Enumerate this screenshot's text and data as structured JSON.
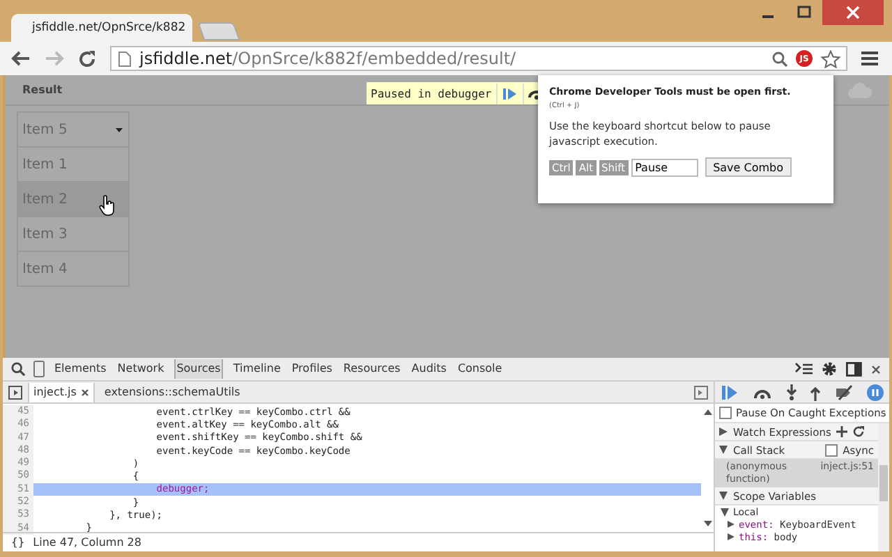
{
  "browser": {
    "tab_title": "jsfiddle.net/OpnSrce/k882",
    "url_host": "jsfiddle.net",
    "url_path": "/OpnSrce/k882f/embedded/result/",
    "extension_badge": "JS"
  },
  "page": {
    "header": "Result",
    "menu_items": [
      {
        "label": "Item 5",
        "kind": "dropdown",
        "hovered": false
      },
      {
        "label": "Item 1",
        "kind": "item",
        "hovered": false
      },
      {
        "label": "Item 2",
        "kind": "item",
        "hovered": true
      },
      {
        "label": "Item 3",
        "kind": "item",
        "hovered": false
      },
      {
        "label": "Item 4",
        "kind": "item",
        "hovered": false
      }
    ],
    "paused_banner": "Paused in debugger"
  },
  "popup": {
    "title": "Chrome Developer Tools must be open first.",
    "shortcut": "(Ctrl + J)",
    "message": "Use the keyboard shortcut below to pause javascript execution.",
    "keys": [
      "Ctrl",
      "Alt",
      "Shift"
    ],
    "key_value": "Pause",
    "save_button": "Save Combo"
  },
  "devtools": {
    "tabs": [
      {
        "label": "Elements",
        "selected": false
      },
      {
        "label": "Network",
        "selected": false
      },
      {
        "label": "Sources",
        "selected": true
      },
      {
        "label": "Timeline",
        "selected": false
      },
      {
        "label": "Profiles",
        "selected": false
      },
      {
        "label": "Resources",
        "selected": false
      },
      {
        "label": "Audits",
        "selected": false
      },
      {
        "label": "Console",
        "selected": false
      }
    ],
    "file_tabs": [
      {
        "label": "inject.js",
        "selected": true
      },
      {
        "label": "extensions::schemaUtils",
        "selected": false
      }
    ],
    "code_lines": [
      {
        "number": "45",
        "text": "                    event.ctrlKey == keyCombo.ctrl &&",
        "highlighted": false
      },
      {
        "number": "46",
        "text": "                    event.altKey == keyCombo.alt &&",
        "highlighted": false
      },
      {
        "number": "47",
        "text": "                    event.shiftKey == keyCombo.shift &&",
        "highlighted": false
      },
      {
        "number": "48",
        "text": "                    event.keyCode == keyCombo.keyCode",
        "highlighted": false
      },
      {
        "number": "49",
        "text": "                )",
        "highlighted": false
      },
      {
        "number": "50",
        "text": "                {",
        "highlighted": false
      },
      {
        "number": "51",
        "text": "                    debugger;",
        "highlighted": true
      },
      {
        "number": "52",
        "text": "                }",
        "highlighted": false
      },
      {
        "number": "53",
        "text": "            }, true);",
        "highlighted": false
      },
      {
        "number": "54",
        "text": "        }",
        "highlighted": false
      }
    ],
    "pretty_print": "{}",
    "status": "Line 47, Column 28",
    "sidebar": {
      "pause_on_caught": {
        "label": "Pause On Caught Exceptions",
        "checked": false
      },
      "watch": {
        "label": "Watch Expressions",
        "expanded": false
      },
      "call_stack": {
        "label": "Call Stack",
        "expanded": true,
        "async": {
          "label": "Async",
          "checked": false
        },
        "frame": {
          "function": "(anonymous function)",
          "location": "inject.js:51"
        }
      },
      "scope": {
        "label": "Scope Variables",
        "expanded": true,
        "local": {
          "label": "Local",
          "expanded": true,
          "vars": [
            {
              "name": "event:",
              "value": "KeyboardEvent"
            },
            {
              "name": "this:",
              "value": "body"
            }
          ]
        }
      }
    }
  }
}
